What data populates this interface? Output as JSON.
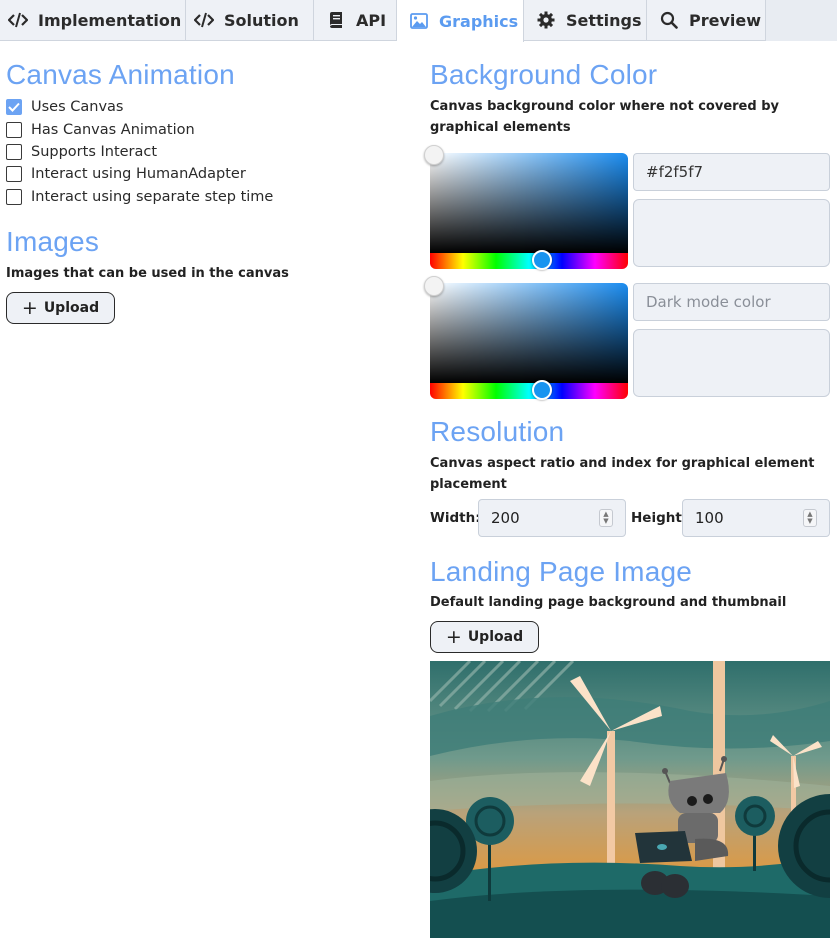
{
  "tabs": [
    {
      "label": "Implementation",
      "icon": "code-icon"
    },
    {
      "label": "Solution",
      "icon": "code-icon"
    },
    {
      "label": "API",
      "icon": "book-icon"
    },
    {
      "label": "Graphics",
      "icon": "image-icon",
      "active": true
    },
    {
      "label": "Settings",
      "icon": "gear-icon"
    },
    {
      "label": "Preview",
      "icon": "search-icon"
    }
  ],
  "canvas_animation": {
    "title": "Canvas Animation",
    "options": [
      {
        "label": "Uses Canvas",
        "checked": true
      },
      {
        "label": "Has Canvas Animation",
        "checked": false
      },
      {
        "label": "Supports Interact",
        "checked": false
      },
      {
        "label": "Interact using HumanAdapter",
        "checked": false
      },
      {
        "label": "Interact using separate step time",
        "checked": false
      }
    ]
  },
  "images": {
    "title": "Images",
    "description": "Images that can be used in the canvas",
    "upload_label": "Upload"
  },
  "background_color": {
    "title": "Background Color",
    "description": "Canvas background color where not covered by graphical elements",
    "light_value": "#f2f5f7",
    "dark_placeholder": "Dark mode color"
  },
  "resolution": {
    "title": "Resolution",
    "description": "Canvas aspect ratio and index for graphical element placement",
    "width_label": "Width:",
    "width_value": "200",
    "height_label": "Height:",
    "height_value": "100"
  },
  "landing_page": {
    "title": "Landing Page Image",
    "description": "Default landing page background and thumbnail",
    "upload_label": "Upload"
  },
  "colors": {
    "accent": "#6ca3f3",
    "tab_bg": "#eef1f6",
    "field_bg": "#eef1f6"
  }
}
